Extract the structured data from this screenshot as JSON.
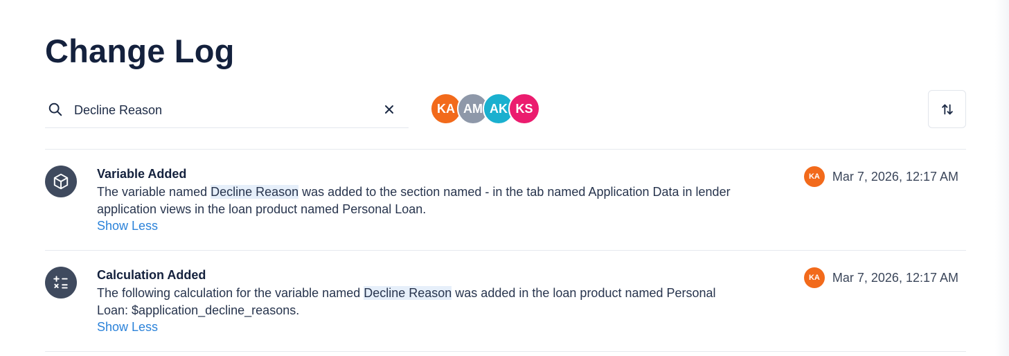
{
  "page": {
    "title": "Change Log"
  },
  "search": {
    "value": "Decline Reason",
    "placeholder": "Search"
  },
  "filters": {
    "avatars": [
      {
        "initials": "KA",
        "color": "#f26a1b"
      },
      {
        "initials": "AM",
        "color": "#8e98a9"
      },
      {
        "initials": "AK",
        "color": "#1ab0cf"
      },
      {
        "initials": "KS",
        "color": "#eb1c6e"
      }
    ]
  },
  "colors": {
    "accent": "#2b82d9",
    "highlight": "#e6effa",
    "icon_bg": "#3f4a5e"
  },
  "entries": [
    {
      "icon": "cube-icon",
      "title": "Variable Added",
      "desc_before": "The variable named ",
      "desc_highlight": "Decline Reason",
      "desc_after": " was added to the section named - in the tab named Application Data in lender application views in the loan product named Personal Loan.",
      "toggle": "Show Less",
      "user_initials": "KA",
      "date": "Mar 7, 2026, 12:17 AM"
    },
    {
      "icon": "calculator-icon",
      "title": "Calculation Added",
      "desc_before": "The following calculation for the variable named ",
      "desc_highlight": "Decline Reason",
      "desc_after": " was added in the loan product named Personal Loan: $application_decline_reasons.",
      "toggle": "Show Less",
      "user_initials": "KA",
      "date": "Mar 7, 2026, 12:17 AM"
    }
  ]
}
